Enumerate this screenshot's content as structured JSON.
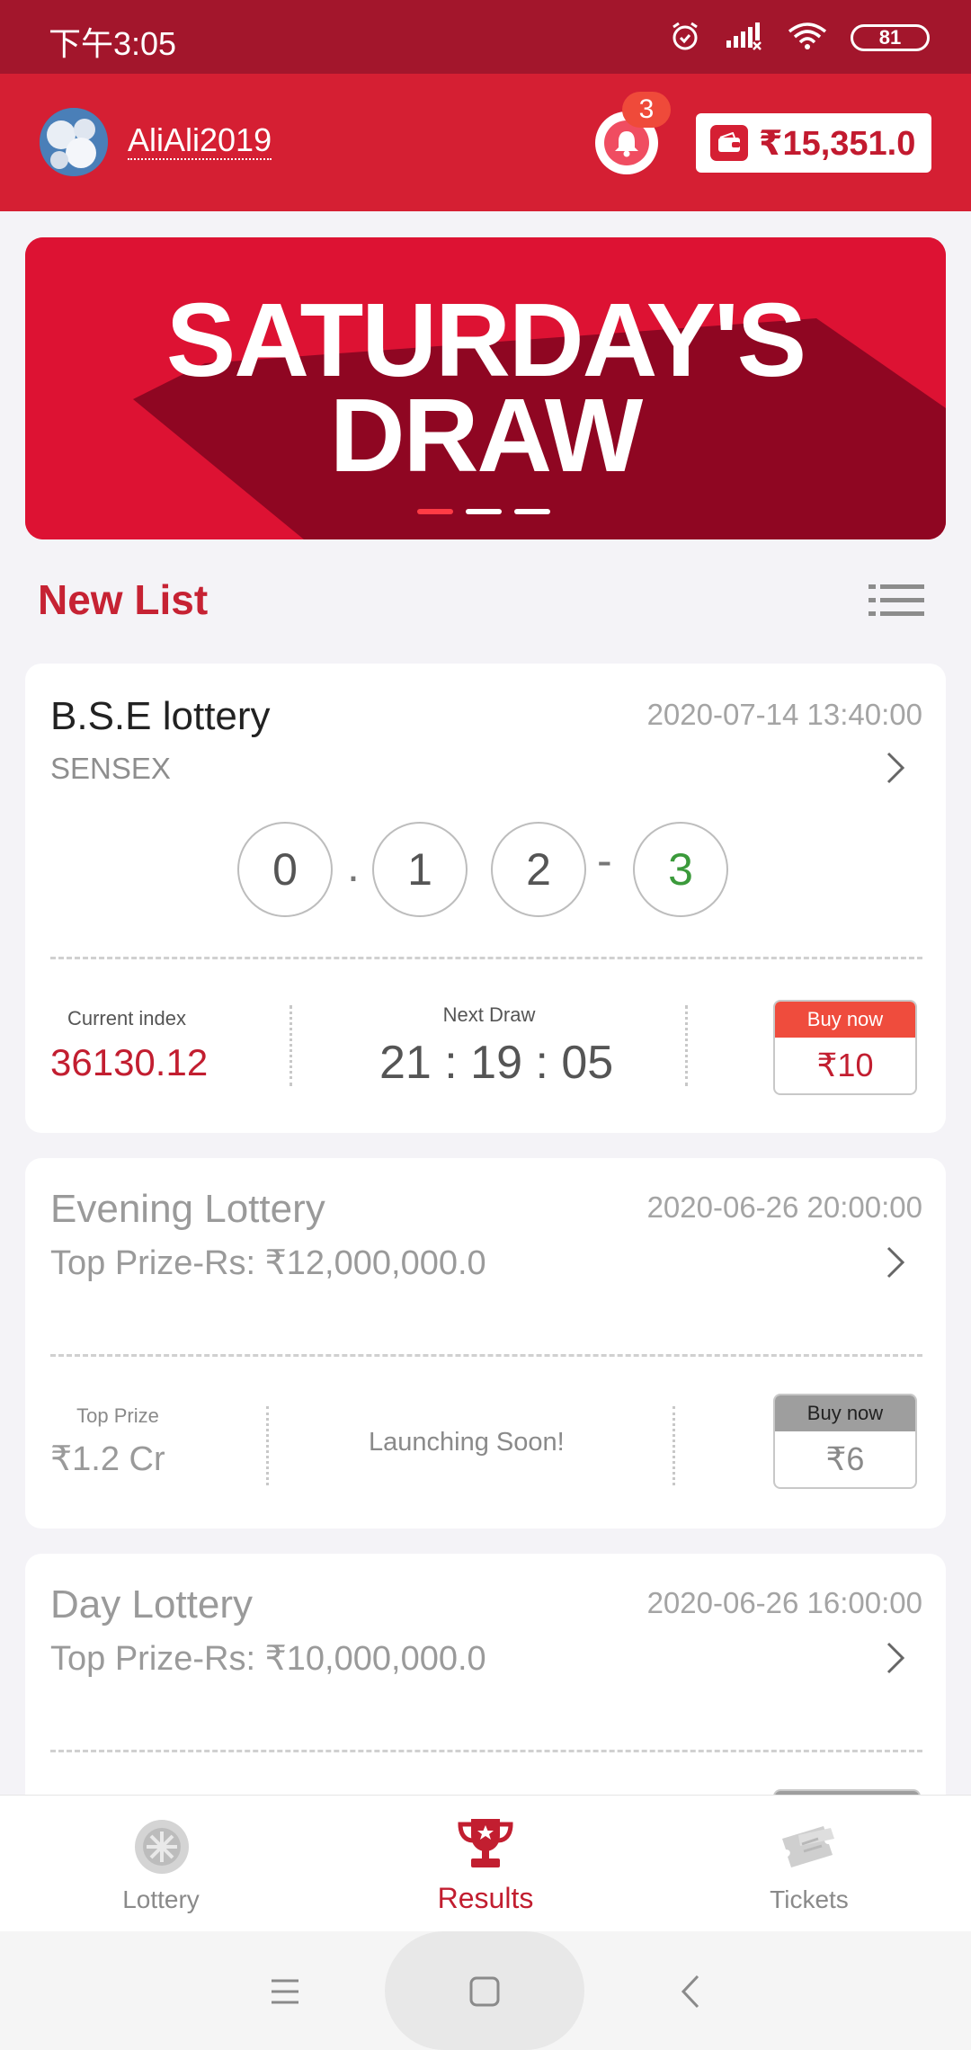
{
  "status_bar": {
    "time": "下午3:05",
    "battery": "81",
    "icons": [
      "alarm-icon",
      "signal-icon",
      "wifi-icon",
      "battery-icon"
    ]
  },
  "header": {
    "username": "AliAli2019",
    "notification_count": "3",
    "wallet_balance": "₹15,351.0"
  },
  "banner": {
    "line1": "SATURDAY'S",
    "line2": "DRAW",
    "slide_count": 3,
    "active_slide": 1
  },
  "section": {
    "title": "New List"
  },
  "cards": [
    {
      "title": "B.S.E lottery",
      "date": "2020-07-14 13:40:00",
      "subtitle": "SENSEX",
      "balls": [
        "0",
        "1",
        "2",
        "3"
      ],
      "separators": [
        ".",
        "-"
      ],
      "left_label": "Current index",
      "left_value": "36130.12",
      "middle_label": "Next Draw",
      "middle_value": "21 : 19 : 05",
      "buy_label": "Buy now",
      "buy_price": "₹10"
    },
    {
      "title": "Evening Lottery",
      "date": "2020-06-26 20:00:00",
      "subtitle": "Top  Prize-Rs: ₹12,000,000.0",
      "left_label": "Top Prize",
      "left_value": "₹1.2 Cr",
      "middle_value": "Launching Soon!",
      "buy_label": "Buy now",
      "buy_price": "₹6"
    },
    {
      "title": "Day Lottery",
      "date": "2020-06-26 16:00:00",
      "subtitle": "Top  Prize-Rs: ₹10,000,000.0"
    }
  ],
  "bottom_nav": [
    {
      "label": "Lottery",
      "icon": "lottery-ball-icon"
    },
    {
      "label": "Results",
      "icon": "trophy-icon",
      "active": true
    },
    {
      "label": "Tickets",
      "icon": "tickets-icon"
    }
  ],
  "colors": {
    "brand_red": "#d51f33",
    "status_bar": "#a3162c",
    "accent_green": "#3b9a3b"
  }
}
